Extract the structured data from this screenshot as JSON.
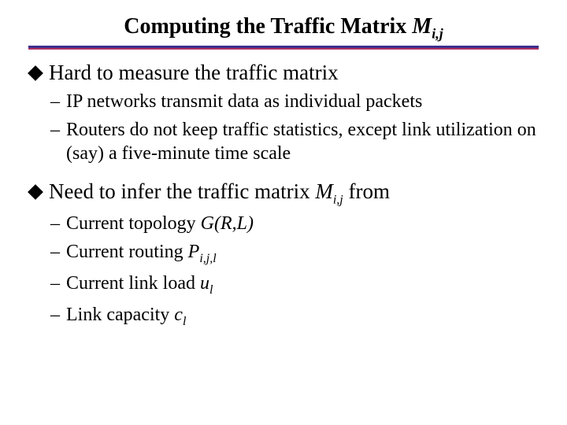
{
  "title": {
    "pre": "Computing the Traffic Matrix ",
    "mvar": "M",
    "msub": "i,j"
  },
  "bullets": [
    {
      "text": "Hard to measure the traffic matrix",
      "sub": [
        {
          "text": "IP networks transmit data as individual packets"
        },
        {
          "text": "Routers do not keep traffic statistics, except link utilization on (say) a five-minute time scale"
        }
      ]
    },
    {
      "pre": "Need to infer the traffic matrix ",
      "mvar": "M",
      "msub": "i,j",
      "post": " from",
      "sub": [
        {
          "pre": "Current topology ",
          "ital": "G(R,L)"
        },
        {
          "pre": "Current routing ",
          "mvar": "P",
          "msub": "i,j,l"
        },
        {
          "pre": "Current link load ",
          "mvar": "u",
          "msub": "l"
        },
        {
          "pre": "Link capacity ",
          "mvar": "c",
          "msub": "l"
        }
      ]
    }
  ]
}
